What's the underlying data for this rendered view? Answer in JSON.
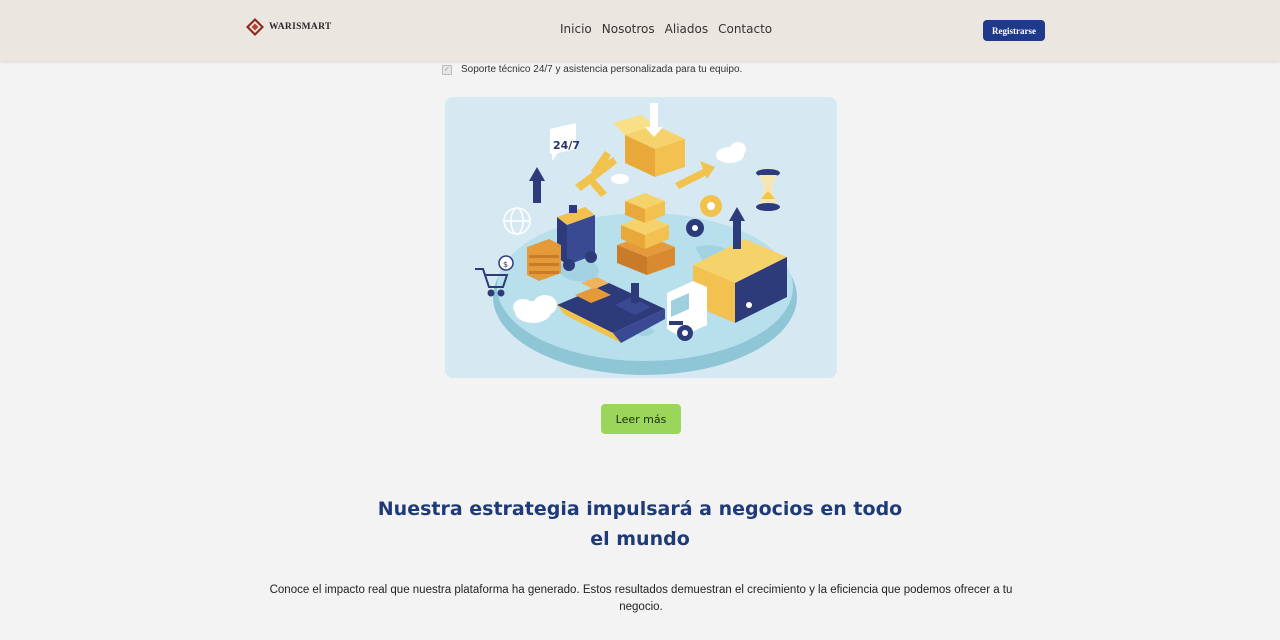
{
  "header": {
    "logo_text": "WARISMART",
    "nav": [
      "Inicio",
      "Nosotros",
      "Aliados",
      "Contacto"
    ],
    "register_label": "Registrarse"
  },
  "feature": {
    "text": "Soporte técnico 24/7 y asistencia personalizada para tu equipo."
  },
  "illustration": {
    "badge_text": "24/7"
  },
  "cta": {
    "read_more_label": "Leer más"
  },
  "section": {
    "title_line1": "Nuestra estrategia impulsará a negocios en todo",
    "title_line2": "el mundo",
    "description": "Conoce el impacto real que nuestra plataforma ha generado. Estos resultados demuestran el crecimiento y la eficiencia que podemos ofrecer a tu negocio."
  },
  "colors": {
    "header_bg": "#ebe6e0",
    "brand_blue": "#1f3a8a",
    "accent_green": "#9bd55a",
    "title_blue": "#1f3a78"
  }
}
